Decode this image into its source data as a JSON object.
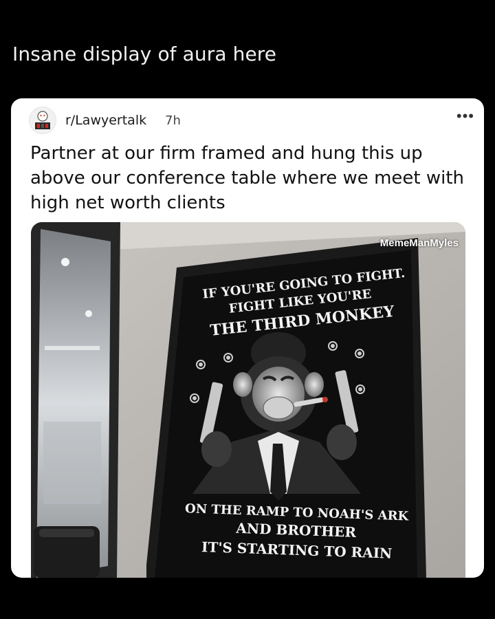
{
  "caption": "Insane display of aura here",
  "post": {
    "subreddit": "r/Lawyertalk",
    "age": "7h",
    "menu_glyph": "•••",
    "title": "Partner at our firm framed and hung this up above our conference table where we meet with high net worth clients",
    "watermark": "MemeManMyles",
    "poster": {
      "top_line_1": "IF YOU'RE GOING TO FIGHT.",
      "top_line_2": "FIGHT LIKE YOU'RE",
      "top_line_3": "THE THIRD MONKEY",
      "bottom_line_1": "ON THE RAMP TO NOAH'S ARK",
      "bottom_line_2": "AND BROTHER",
      "bottom_line_3": "IT'S STARTING TO RAIN"
    }
  },
  "icons": {
    "avatar": "subreddit-avatar-icon",
    "menu": "more-options-icon"
  }
}
